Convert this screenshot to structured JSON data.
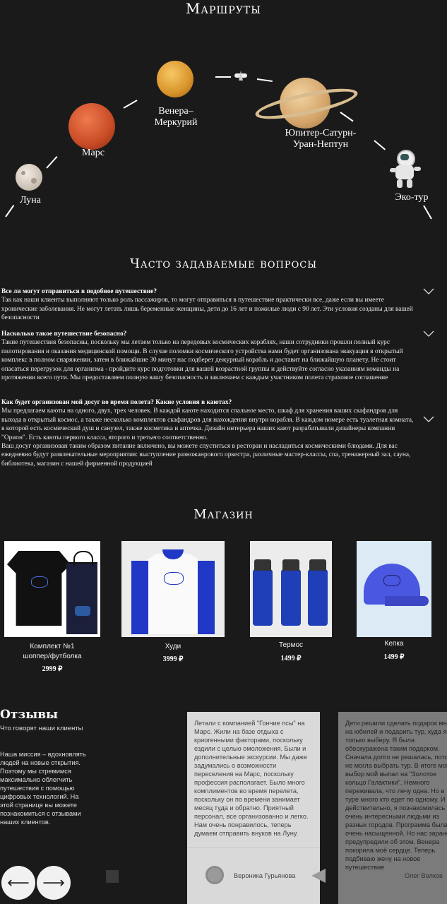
{
  "routes": {
    "title": "Маршруты",
    "stops": [
      {
        "name": "Луна",
        "icon": "moon-icon"
      },
      {
        "name": "Марс",
        "icon": "mars-icon"
      },
      {
        "name": "Венера–Меркурий",
        "icon": "venus-icon"
      },
      {
        "name": "Юпитер-Сатурн-Уран-Нептун",
        "line1": "Юпитер-Сатурн-",
        "line2": "Уран-Нептун",
        "icon": "saturn-icon"
      },
      {
        "name": "Эко-тур",
        "icon": "astronaut-icon"
      }
    ],
    "ship_icon": "spaceship-icon"
  },
  "faq": {
    "title": "Часто задаваемые вопросы",
    "items": [
      {
        "q": "Все ли могут отправиться в подобное путешествие?",
        "a": "Так как наши клиенты выполняют только роль пассажиров, то могут отправиться в путешествие практически все, даже если вы имеете хронические заболевания. Не могут летать лишь беременные женщины, дети до 16 лет и пожилые люди с 90 лет. Эти условия созданы для вашей безопасности"
      },
      {
        "q": "Насколько такое путешествие безопасно?",
        "a": "Такие путешествия безопасны, поскольку мы летаем только на передовых космических кораблях, наши сотрудники прошли полный курс пилотирования и оказания медицинской помощи. В случае поломки космического устройства нами будет организована эвакуация в открытый комплекс в полном снаряжении, затем в ближайшие 30 минут нас подберет дежурный корабль и доставит на ближайшую планету. Не стоит опасаться перегрузок для организма - пройдите курс подготовки для вашей возрастной группы и действуйте согласно указаниям команды на протяжении всего пути. Мы предоставляем полную вашу безопасность и заключаем с каждым участником полета страховое соглашение"
      },
      {
        "q": "Как будет организован мой досуг во время полета? Какие условия в каютах?",
        "a": "Мы предлагаем каюты на одного, двух, трех человек. В каждой каюте находится спальное место, шкаф для хранения ваших скафандров для выхода в открытый космос, а также несколько комплектов скафандров для нахождения внутри корабля. В каждом номере есть туалетная комната, в которой есть космический душ и санузел, также косметика и аптечка. Дизайн интерьера наших кают разрабатывали дизайнеры компании \"Орион\". Есть каюты первого класса, второго и третьего соответственно.",
        "a2": "Ваш досуг организован таким образом питание включено, вы можете спуститься в ресторан и насладиться космическими блюдами. Для вас ежедневно будут развлекательные мероприятия: выступление разножанрового оркестра, различные мастер-классы, спа, тренажерный зал, сауна, библиотека, магазин с нашей фирменной продукцией"
      }
    ]
  },
  "shop": {
    "title": "Магазин",
    "products": [
      {
        "name_line1": "Комплект №1",
        "name_line2": "шоппер/футболка",
        "price": "2999 ₽"
      },
      {
        "name_line1": "Худи",
        "name_line2": "",
        "price": "3999 ₽"
      },
      {
        "name_line1": "Термос",
        "name_line2": "",
        "price": "1499 ₽"
      },
      {
        "name_line1": "Кепка",
        "name_line2": "",
        "price": "1499 ₽"
      }
    ]
  },
  "reviews": {
    "title": "Отзывы",
    "subtitle": "Что говорят наши клиенты",
    "mission": "Наша миссия – вдохновлять людей на новые открытия. Поэтому мы стремимся максимально облегчить путешествия с помощью цифровых технологий. На этой странице вы можете познакомиться с отзывами наших клиентов.",
    "prev_label": "⟵",
    "next_label": "⟶",
    "cards": [
      {
        "text": "Летали с компанией \"Гончие псы\" на Марс. Жили на базе отдыха с криогенными факторами, поскольку ездили с целью омоложения. Были и дополнительные экскурсии. Мы даже задумались о возможности переселения на Марс, поскольку профессия располагает. Было много комплиментов во время перелета, поскольку он по времени занимает месяц туда и обратно. Приятный персонал, все организованно и легко. Нам очень понравилось, теперь думаем отправить внуков на Луну.",
        "author": "Вероника Гурьянова"
      },
      {
        "text": "Дети решили сделать подарок мне на юбилей и подарить тур, куда я только выберу. Я была обескуражена таким подарком. Сначала долго не решалась, потом не могла выбрать тур. В итоге мой выбор мой выпал на \"Золотое кольцо Галактики\". Немного переживала, что лечу одна. Но в туре много кто едет по одному. И действительно, я познакомилась с очень интересными людьми из разных городов. Программа была очень насыщенной. Но нас заранее предупредили об этом. Венера покорила моё сердце. Теперь подбиваю жену на новое путешествие",
        "author": "Олег Волков"
      }
    ]
  },
  "colors": {
    "background": "#1b1a1a",
    "card_light": "#d9d9d9",
    "card_dark": "#7b7b7b",
    "brand_blue": "#2437c8"
  }
}
